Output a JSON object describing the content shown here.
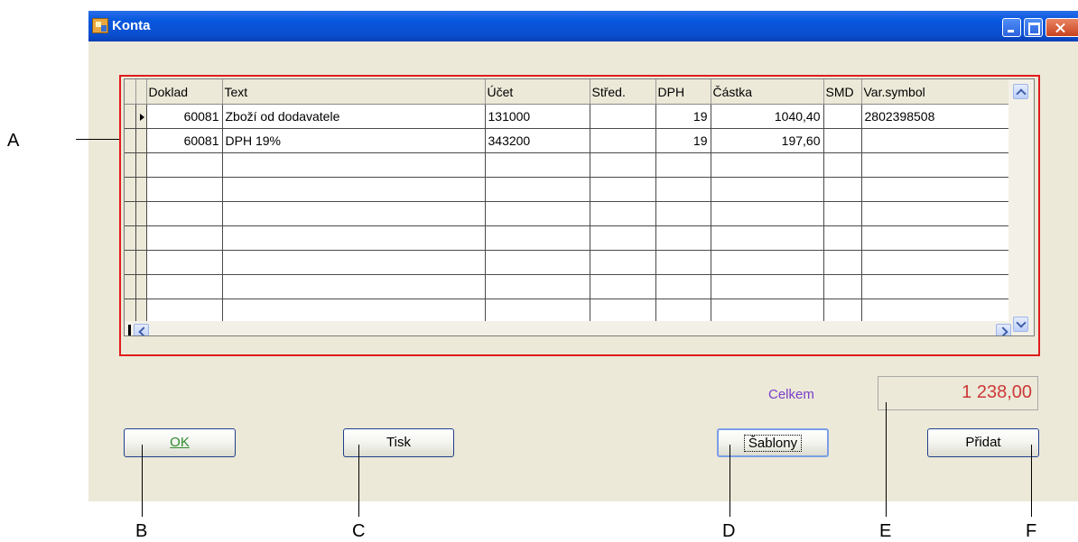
{
  "window": {
    "title": "Konta"
  },
  "grid": {
    "columns": [
      "Doklad",
      "Text",
      "Účet",
      "Střed.",
      "DPH",
      "Částka",
      "SMD",
      "Var.symbol"
    ],
    "rows": [
      {
        "doklad": "60081",
        "text": "Zboží od dodavatele",
        "ucet": "131000",
        "stred": "",
        "dph": "19",
        "castka": "1040,40",
        "smd": "",
        "var_symbol": "2802398508"
      },
      {
        "doklad": "60081",
        "text": "DPH 19%",
        "ucet": "343200",
        "stred": "",
        "dph": "19",
        "castka": "197,60",
        "smd": "",
        "var_symbol": ""
      }
    ]
  },
  "total": {
    "label": "Celkem",
    "value": "1 238,00"
  },
  "buttons": {
    "ok": "OK",
    "tisk": "Tisk",
    "sablony": "Šablony",
    "pridat": "Přidat"
  },
  "callouts": {
    "a": "A",
    "b": "B",
    "c": "C",
    "d": "D",
    "e": "E",
    "f": "F"
  },
  "colors": {
    "highlight_outline": "#e01c1c",
    "total_label": "#7b3fc9",
    "total_value": "#cc3838",
    "titlebar": "#0a4fd1"
  }
}
